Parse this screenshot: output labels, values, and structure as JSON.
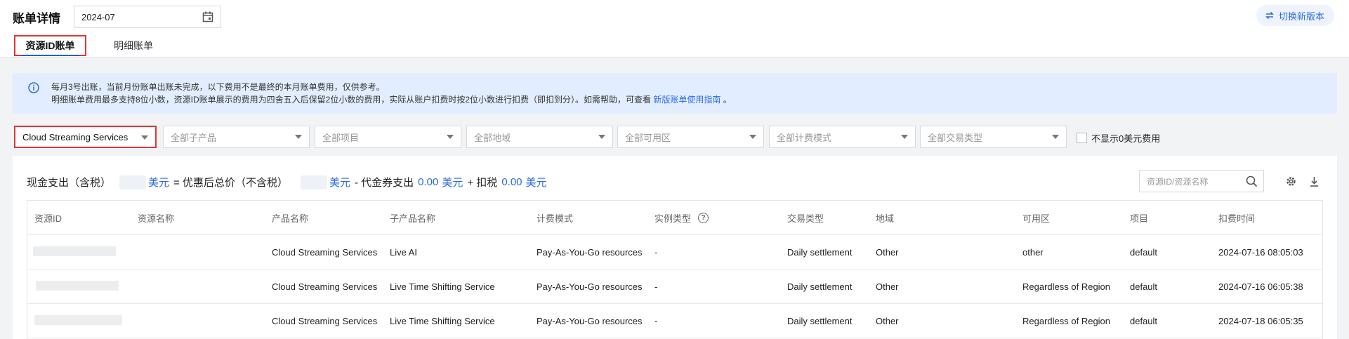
{
  "header": {
    "title": "账单详情",
    "date_value": "2024-07",
    "switch_label": "切换新版本",
    "tabs": [
      {
        "label": "资源ID账单",
        "active": true
      },
      {
        "label": "明细账单",
        "active": false
      }
    ]
  },
  "notice": {
    "line1": "每月3号出账，当前月份账单出账未完成，以下费用不是最终的本月账单费用，仅供参考。",
    "line2_prefix": "明细账单费用最多支持8位小数，资源ID账单展示的费用为四舍五入后保留2位小数的费用，实际从账户扣费时按2位小数进行扣费（即扣到分）。如需帮助，可查看",
    "line2_link": "新版账单使用指南",
    "line2_suffix": "。"
  },
  "filters": {
    "product": "Cloud Streaming Services",
    "subproduct": "全部子产品",
    "project": "全部项目",
    "region": "全部地域",
    "zone": "全部可用区",
    "billing_mode": "全部计费模式",
    "transaction_type": "全部交易类型",
    "hide_zero_label": "不显示0美元费用"
  },
  "summary": {
    "cash_label": "现金支出（含税）",
    "unit": "美元",
    "eq_label": "= 优惠后总价（不含税）",
    "voucher_label": "- 代金券支出",
    "voucher_value": "0.00",
    "tax_label": "+ 扣税",
    "tax_value": "0.00"
  },
  "search": {
    "placeholder": "资源ID/资源名称"
  },
  "table": {
    "columns": [
      "资源ID",
      "资源名称",
      "产品名称",
      "子产品名称",
      "计费模式",
      "实例类型",
      "交易类型",
      "地域",
      "可用区",
      "项目",
      "扣费时间"
    ],
    "rows": [
      [
        "",
        "",
        "Cloud Streaming Services",
        "Live AI",
        "Pay-As-You-Go resources",
        "-",
        "Daily settlement",
        "Other",
        "other",
        "default",
        "2024-07-16 08:05:03"
      ],
      [
        "",
        "",
        "Cloud Streaming Services",
        "Live Time Shifting Service",
        "Pay-As-You-Go resources",
        "-",
        "Daily settlement",
        "Other",
        "Regardless of Region",
        "default",
        "2024-07-16 06:05:38"
      ],
      [
        "",
        "",
        "Cloud Streaming Services",
        "Live Time Shifting Service",
        "Pay-As-You-Go resources",
        "-",
        "Daily settlement",
        "Other",
        "Regardless of Region",
        "default",
        "2024-07-18 06:05:35"
      ]
    ]
  },
  "colors": {
    "accent": "#2d6ae0",
    "highlight_border": "#e03636",
    "notice_bg": "#e2eeff"
  }
}
